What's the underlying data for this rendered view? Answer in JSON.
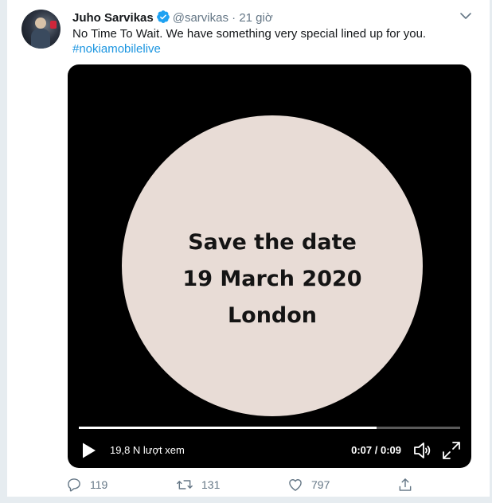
{
  "tweet": {
    "author_name": "Juho Sarvikas",
    "handle": "@sarvikas",
    "separator": "·",
    "time": "21 giờ",
    "text": "No Time To Wait. We have something very special lined up for you.",
    "hashtag": "#nokiamobilelive"
  },
  "video": {
    "line1": "Save the date",
    "line2": "19 March 2020",
    "line3": "London",
    "views": "19,8 N lượt xem",
    "time_display": "0:07 / 0:09",
    "progress_fraction": 0.78
  },
  "actions": {
    "replies": "119",
    "retweets": "131",
    "likes": "797"
  },
  "colors": {
    "accent": "#1da1f2",
    "hashtag": "#1b95e0",
    "muted": "#657786",
    "circle": "#e8dcd6"
  },
  "icons": [
    "verified-badge-icon",
    "caret-down-icon",
    "play-icon",
    "volume-icon",
    "fullscreen-icon",
    "reply-icon",
    "retweet-icon",
    "like-icon",
    "share-icon"
  ]
}
